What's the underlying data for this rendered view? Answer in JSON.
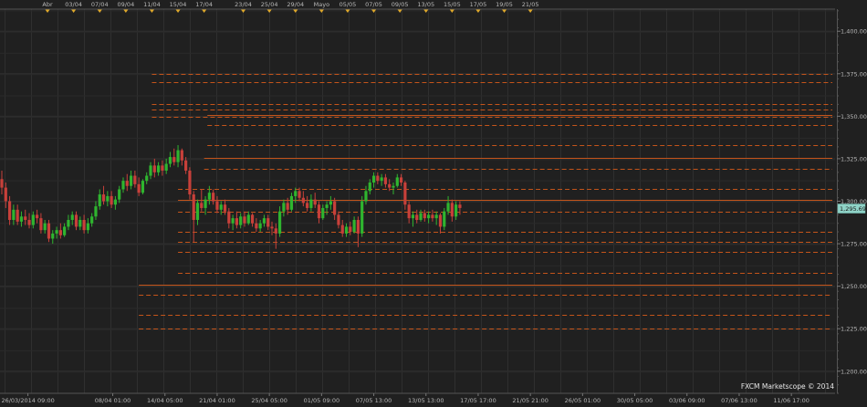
{
  "watermark": "FXCM Marketscope © 2014",
  "colors": {
    "background": "#202020",
    "grid": "#2f2f2f",
    "bull": "#2fb52f",
    "bear": "#c8403a",
    "level_line": "#c4541a",
    "price_box": "#8fd3c7",
    "marker": "#e0a92a"
  },
  "chart_data": {
    "type": "candlestick",
    "ylim": [
      1187,
      1413
    ],
    "xlim": [
      0,
      129
    ],
    "grid": true,
    "current_price_label": "1,295.69",
    "current_price": 1295.69,
    "y_ticks": [
      {
        "value": 1400,
        "label": "1,400.00"
      },
      {
        "value": 1375,
        "label": "1,375.00"
      },
      {
        "value": 1350,
        "label": "1,350.00"
      },
      {
        "value": 1325,
        "label": "1,325.00"
      },
      {
        "value": 1300,
        "label": "1,300.00"
      },
      {
        "value": 1275,
        "label": "1,275.00"
      },
      {
        "value": 1250,
        "label": "1,250.00"
      },
      {
        "value": 1225,
        "label": "1,225.00"
      },
      {
        "value": 1200,
        "label": "1,200.00"
      }
    ],
    "top_axis": [
      {
        "x": 7,
        "label": "Abr"
      },
      {
        "x": 11,
        "label": "03/04"
      },
      {
        "x": 15,
        "label": "07/04"
      },
      {
        "x": 19,
        "label": "09/04"
      },
      {
        "x": 23,
        "label": "11/04"
      },
      {
        "x": 27,
        "label": "15/04"
      },
      {
        "x": 31,
        "label": "17/04"
      },
      {
        "x": 37,
        "label": "23/04"
      },
      {
        "x": 41,
        "label": "25/04"
      },
      {
        "x": 45,
        "label": "29/04"
      },
      {
        "x": 49,
        "label": "Mayo"
      },
      {
        "x": 53,
        "label": "05/05"
      },
      {
        "x": 57,
        "label": "07/05"
      },
      {
        "x": 61,
        "label": "09/05"
      },
      {
        "x": 65,
        "label": "13/05"
      },
      {
        "x": 69,
        "label": "15/05"
      },
      {
        "x": 73,
        "label": "17/05"
      },
      {
        "x": 77,
        "label": "19/05"
      },
      {
        "x": 81,
        "label": "21/05"
      }
    ],
    "bottom_axis": [
      {
        "x": 4,
        "label": "26/03/2014 09:00"
      },
      {
        "x": 17,
        "label": "08/04 01:00"
      },
      {
        "x": 25,
        "label": "14/04 05:00"
      },
      {
        "x": 33,
        "label": "21/04 01:00"
      },
      {
        "x": 41,
        "label": "25/04 05:00"
      },
      {
        "x": 49,
        "label": "01/05 09:00"
      },
      {
        "x": 57,
        "label": "07/05 13:00"
      },
      {
        "x": 65,
        "label": "13/05 13:00"
      },
      {
        "x": 73,
        "label": "17/05 17:00"
      },
      {
        "x": 81,
        "label": "21/05 21:00"
      },
      {
        "x": 89,
        "label": "26/05 01:00"
      },
      {
        "x": 97,
        "label": "30/05 05:00"
      },
      {
        "x": 105,
        "label": "03/06 09:00"
      },
      {
        "x": 113,
        "label": "07/06 13:00"
      },
      {
        "x": 121,
        "label": "11/06 17:00"
      }
    ],
    "levels": [
      {
        "price": 1375.0,
        "x_from": 23.0,
        "style": "dashed"
      },
      {
        "price": 1370.0,
        "x_from": 23.0,
        "style": "dashed"
      },
      {
        "price": 1357.0,
        "x_from": 23.0,
        "style": "dashed"
      },
      {
        "price": 1354.0,
        "x_from": 23.0,
        "style": "dashed"
      },
      {
        "price": 1350.5,
        "x_from": 31.5,
        "style": "solid"
      },
      {
        "price": 1349.5,
        "x_from": 23.0,
        "style": "dashed"
      },
      {
        "price": 1345.0,
        "x_from": 31.5,
        "style": "dashed"
      },
      {
        "price": 1333.0,
        "x_from": 31.5,
        "style": "dashed"
      },
      {
        "price": 1325.5,
        "x_from": 31.0,
        "style": "solid"
      },
      {
        "price": 1319.0,
        "x_from": 31.0,
        "style": "dashed"
      },
      {
        "price": 1307.0,
        "x_from": 27.0,
        "style": "dashed"
      },
      {
        "price": 1301.0,
        "x_from": 27.0,
        "style": "solid"
      },
      {
        "price": 1294.0,
        "x_from": 27.0,
        "style": "dashed"
      },
      {
        "price": 1282.0,
        "x_from": 27.0,
        "style": "dashed"
      },
      {
        "price": 1276.0,
        "x_from": 27.0,
        "style": "dashed"
      },
      {
        "price": 1270.0,
        "x_from": 27.0,
        "style": "dashed"
      },
      {
        "price": 1258.0,
        "x_from": 27.0,
        "style": "dashed"
      },
      {
        "price": 1251.0,
        "x_from": 21.0,
        "style": "solid"
      },
      {
        "price": 1245.0,
        "x_from": 21.0,
        "style": "dashed"
      },
      {
        "price": 1233.0,
        "x_from": 21.0,
        "style": "dashed"
      },
      {
        "price": 1225.0,
        "x_from": 21.0,
        "style": "dashed"
      }
    ],
    "candles": [
      {
        "x": 0.0,
        "o": 1313,
        "h": 1318,
        "l": 1304,
        "c": 1308
      },
      {
        "x": 0.6,
        "o": 1308,
        "h": 1311,
        "l": 1296,
        "c": 1300
      },
      {
        "x": 1.2,
        "o": 1300,
        "h": 1303,
        "l": 1286,
        "c": 1289
      },
      {
        "x": 1.8,
        "o": 1289,
        "h": 1298,
        "l": 1286,
        "c": 1295
      },
      {
        "x": 2.4,
        "o": 1295,
        "h": 1298,
        "l": 1286,
        "c": 1288
      },
      {
        "x": 3.0,
        "o": 1288,
        "h": 1294,
        "l": 1285,
        "c": 1291
      },
      {
        "x": 3.6,
        "o": 1291,
        "h": 1295,
        "l": 1286,
        "c": 1289
      },
      {
        "x": 4.2,
        "o": 1289,
        "h": 1293,
        "l": 1284,
        "c": 1286
      },
      {
        "x": 4.8,
        "o": 1286,
        "h": 1294,
        "l": 1284,
        "c": 1292
      },
      {
        "x": 5.4,
        "o": 1292,
        "h": 1295,
        "l": 1287,
        "c": 1290
      },
      {
        "x": 6.0,
        "o": 1290,
        "h": 1293,
        "l": 1281,
        "c": 1283
      },
      {
        "x": 6.6,
        "o": 1283,
        "h": 1289,
        "l": 1281,
        "c": 1287
      },
      {
        "x": 7.2,
        "o": 1287,
        "h": 1289,
        "l": 1276,
        "c": 1278
      },
      {
        "x": 7.8,
        "o": 1278,
        "h": 1283,
        "l": 1275,
        "c": 1281
      },
      {
        "x": 8.4,
        "o": 1281,
        "h": 1285,
        "l": 1278,
        "c": 1283
      },
      {
        "x": 9.0,
        "o": 1283,
        "h": 1287,
        "l": 1278,
        "c": 1280
      },
      {
        "x": 9.6,
        "o": 1280,
        "h": 1287,
        "l": 1279,
        "c": 1285
      },
      {
        "x": 10.2,
        "o": 1285,
        "h": 1292,
        "l": 1283,
        "c": 1289
      },
      {
        "x": 10.8,
        "o": 1289,
        "h": 1294,
        "l": 1286,
        "c": 1292
      },
      {
        "x": 11.4,
        "o": 1292,
        "h": 1294,
        "l": 1283,
        "c": 1285
      },
      {
        "x": 12.0,
        "o": 1285,
        "h": 1291,
        "l": 1283,
        "c": 1289
      },
      {
        "x": 12.6,
        "o": 1289,
        "h": 1292,
        "l": 1281,
        "c": 1283
      },
      {
        "x": 13.2,
        "o": 1283,
        "h": 1290,
        "l": 1281,
        "c": 1287
      },
      {
        "x": 13.8,
        "o": 1287,
        "h": 1293,
        "l": 1285,
        "c": 1291
      },
      {
        "x": 14.4,
        "o": 1291,
        "h": 1300,
        "l": 1289,
        "c": 1297
      },
      {
        "x": 15.0,
        "o": 1297,
        "h": 1307,
        "l": 1295,
        "c": 1304
      },
      {
        "x": 15.6,
        "o": 1304,
        "h": 1309,
        "l": 1298,
        "c": 1300
      },
      {
        "x": 16.2,
        "o": 1300,
        "h": 1306,
        "l": 1297,
        "c": 1303
      },
      {
        "x": 16.8,
        "o": 1303,
        "h": 1306,
        "l": 1296,
        "c": 1298
      },
      {
        "x": 17.4,
        "o": 1298,
        "h": 1303,
        "l": 1295,
        "c": 1301
      },
      {
        "x": 18.0,
        "o": 1301,
        "h": 1309,
        "l": 1299,
        "c": 1307
      },
      {
        "x": 18.6,
        "o": 1307,
        "h": 1314,
        "l": 1305,
        "c": 1312
      },
      {
        "x": 19.2,
        "o": 1312,
        "h": 1316,
        "l": 1306,
        "c": 1309
      },
      {
        "x": 19.8,
        "o": 1309,
        "h": 1318,
        "l": 1307,
        "c": 1315
      },
      {
        "x": 20.4,
        "o": 1315,
        "h": 1318,
        "l": 1308,
        "c": 1310
      },
      {
        "x": 21.0,
        "o": 1310,
        "h": 1314,
        "l": 1303,
        "c": 1305
      },
      {
        "x": 21.6,
        "o": 1305,
        "h": 1313,
        "l": 1304,
        "c": 1312
      },
      {
        "x": 22.2,
        "o": 1312,
        "h": 1317,
        "l": 1310,
        "c": 1315
      },
      {
        "x": 22.8,
        "o": 1315,
        "h": 1323,
        "l": 1313,
        "c": 1321
      },
      {
        "x": 23.4,
        "o": 1321,
        "h": 1325,
        "l": 1314,
        "c": 1317
      },
      {
        "x": 24.0,
        "o": 1317,
        "h": 1323,
        "l": 1315,
        "c": 1321
      },
      {
        "x": 24.6,
        "o": 1321,
        "h": 1324,
        "l": 1315,
        "c": 1318
      },
      {
        "x": 25.2,
        "o": 1318,
        "h": 1325,
        "l": 1316,
        "c": 1322
      },
      {
        "x": 25.8,
        "o": 1322,
        "h": 1329,
        "l": 1320,
        "c": 1326
      },
      {
        "x": 26.4,
        "o": 1326,
        "h": 1331,
        "l": 1321,
        "c": 1323
      },
      {
        "x": 27.0,
        "o": 1323,
        "h": 1333,
        "l": 1320,
        "c": 1330
      },
      {
        "x": 27.6,
        "o": 1330,
        "h": 1331,
        "l": 1321,
        "c": 1324
      },
      {
        "x": 28.2,
        "o": 1324,
        "h": 1326,
        "l": 1316,
        "c": 1318
      },
      {
        "x": 28.8,
        "o": 1318,
        "h": 1320,
        "l": 1301,
        "c": 1304
      },
      {
        "x": 29.4,
        "o": 1304,
        "h": 1306,
        "l": 1276,
        "c": 1289
      },
      {
        "x": 30.0,
        "o": 1289,
        "h": 1301,
        "l": 1286,
        "c": 1299
      },
      {
        "x": 30.6,
        "o": 1299,
        "h": 1307,
        "l": 1294,
        "c": 1296
      },
      {
        "x": 31.2,
        "o": 1296,
        "h": 1303,
        "l": 1292,
        "c": 1301
      },
      {
        "x": 31.8,
        "o": 1301,
        "h": 1309,
        "l": 1298,
        "c": 1305
      },
      {
        "x": 32.4,
        "o": 1305,
        "h": 1307,
        "l": 1298,
        "c": 1300
      },
      {
        "x": 33.0,
        "o": 1300,
        "h": 1303,
        "l": 1293,
        "c": 1295
      },
      {
        "x": 33.6,
        "o": 1295,
        "h": 1300,
        "l": 1292,
        "c": 1298
      },
      {
        "x": 34.2,
        "o": 1298,
        "h": 1301,
        "l": 1292,
        "c": 1294
      },
      {
        "x": 34.8,
        "o": 1294,
        "h": 1296,
        "l": 1284,
        "c": 1287
      },
      {
        "x": 35.4,
        "o": 1287,
        "h": 1292,
        "l": 1283,
        "c": 1290
      },
      {
        "x": 36.0,
        "o": 1290,
        "h": 1294,
        "l": 1284,
        "c": 1286
      },
      {
        "x": 36.6,
        "o": 1286,
        "h": 1293,
        "l": 1284,
        "c": 1291
      },
      {
        "x": 37.2,
        "o": 1291,
        "h": 1294,
        "l": 1285,
        "c": 1287
      },
      {
        "x": 37.8,
        "o": 1287,
        "h": 1294,
        "l": 1286,
        "c": 1292
      },
      {
        "x": 38.4,
        "o": 1292,
        "h": 1293,
        "l": 1285,
        "c": 1287
      },
      {
        "x": 39.0,
        "o": 1287,
        "h": 1290,
        "l": 1282,
        "c": 1284
      },
      {
        "x": 39.6,
        "o": 1284,
        "h": 1289,
        "l": 1282,
        "c": 1287
      },
      {
        "x": 40.2,
        "o": 1287,
        "h": 1292,
        "l": 1285,
        "c": 1290
      },
      {
        "x": 40.8,
        "o": 1290,
        "h": 1292,
        "l": 1283,
        "c": 1285
      },
      {
        "x": 41.4,
        "o": 1285,
        "h": 1288,
        "l": 1280,
        "c": 1284
      },
      {
        "x": 42.0,
        "o": 1284,
        "h": 1287,
        "l": 1272,
        "c": 1281
      },
      {
        "x": 42.6,
        "o": 1281,
        "h": 1297,
        "l": 1279,
        "c": 1294
      },
      {
        "x": 43.2,
        "o": 1294,
        "h": 1301,
        "l": 1291,
        "c": 1299
      },
      {
        "x": 43.8,
        "o": 1299,
        "h": 1302,
        "l": 1292,
        "c": 1295
      },
      {
        "x": 44.4,
        "o": 1295,
        "h": 1305,
        "l": 1294,
        "c": 1303
      },
      {
        "x": 45.0,
        "o": 1303,
        "h": 1308,
        "l": 1299,
        "c": 1306
      },
      {
        "x": 45.6,
        "o": 1306,
        "h": 1308,
        "l": 1300,
        "c": 1302
      },
      {
        "x": 46.2,
        "o": 1302,
        "h": 1306,
        "l": 1297,
        "c": 1299
      },
      {
        "x": 46.8,
        "o": 1299,
        "h": 1303,
        "l": 1294,
        "c": 1296
      },
      {
        "x": 47.4,
        "o": 1296,
        "h": 1304,
        "l": 1294,
        "c": 1301
      },
      {
        "x": 48.0,
        "o": 1301,
        "h": 1305,
        "l": 1296,
        "c": 1298
      },
      {
        "x": 48.6,
        "o": 1298,
        "h": 1300,
        "l": 1287,
        "c": 1290
      },
      {
        "x": 49.2,
        "o": 1290,
        "h": 1298,
        "l": 1289,
        "c": 1296
      },
      {
        "x": 49.8,
        "o": 1296,
        "h": 1300,
        "l": 1292,
        "c": 1298
      },
      {
        "x": 50.4,
        "o": 1298,
        "h": 1303,
        "l": 1295,
        "c": 1300
      },
      {
        "x": 51.0,
        "o": 1300,
        "h": 1302,
        "l": 1289,
        "c": 1292
      },
      {
        "x": 51.6,
        "o": 1292,
        "h": 1294,
        "l": 1284,
        "c": 1286
      },
      {
        "x": 52.2,
        "o": 1286,
        "h": 1289,
        "l": 1279,
        "c": 1281
      },
      {
        "x": 52.8,
        "o": 1281,
        "h": 1287,
        "l": 1279,
        "c": 1285
      },
      {
        "x": 53.4,
        "o": 1285,
        "h": 1288,
        "l": 1280,
        "c": 1282
      },
      {
        "x": 54.0,
        "o": 1282,
        "h": 1291,
        "l": 1281,
        "c": 1289
      },
      {
        "x": 54.6,
        "o": 1289,
        "h": 1291,
        "l": 1273,
        "c": 1281
      },
      {
        "x": 55.2,
        "o": 1281,
        "h": 1303,
        "l": 1279,
        "c": 1300
      },
      {
        "x": 55.8,
        "o": 1300,
        "h": 1309,
        "l": 1298,
        "c": 1306
      },
      {
        "x": 56.4,
        "o": 1306,
        "h": 1313,
        "l": 1304,
        "c": 1311
      },
      {
        "x": 57.0,
        "o": 1311,
        "h": 1317,
        "l": 1308,
        "c": 1315
      },
      {
        "x": 57.6,
        "o": 1315,
        "h": 1317,
        "l": 1310,
        "c": 1312
      },
      {
        "x": 58.2,
        "o": 1312,
        "h": 1316,
        "l": 1309,
        "c": 1314
      },
      {
        "x": 58.8,
        "o": 1314,
        "h": 1316,
        "l": 1308,
        "c": 1310
      },
      {
        "x": 59.4,
        "o": 1310,
        "h": 1313,
        "l": 1306,
        "c": 1308
      },
      {
        "x": 60.0,
        "o": 1308,
        "h": 1311,
        "l": 1304,
        "c": 1309
      },
      {
        "x": 60.6,
        "o": 1309,
        "h": 1316,
        "l": 1308,
        "c": 1314
      },
      {
        "x": 61.2,
        "o": 1314,
        "h": 1316,
        "l": 1309,
        "c": 1311
      },
      {
        "x": 61.8,
        "o": 1311,
        "h": 1312,
        "l": 1295,
        "c": 1298
      },
      {
        "x": 62.4,
        "o": 1298,
        "h": 1300,
        "l": 1287,
        "c": 1290
      },
      {
        "x": 63.0,
        "o": 1290,
        "h": 1294,
        "l": 1285,
        "c": 1292
      },
      {
        "x": 63.6,
        "o": 1292,
        "h": 1295,
        "l": 1287,
        "c": 1289
      },
      {
        "x": 64.2,
        "o": 1289,
        "h": 1295,
        "l": 1288,
        "c": 1293
      },
      {
        "x": 64.8,
        "o": 1293,
        "h": 1295,
        "l": 1288,
        "c": 1290
      },
      {
        "x": 65.4,
        "o": 1290,
        "h": 1294,
        "l": 1287,
        "c": 1292
      },
      {
        "x": 66.0,
        "o": 1292,
        "h": 1295,
        "l": 1288,
        "c": 1290
      },
      {
        "x": 66.6,
        "o": 1290,
        "h": 1294,
        "l": 1286,
        "c": 1292
      },
      {
        "x": 67.2,
        "o": 1292,
        "h": 1293,
        "l": 1281,
        "c": 1285
      },
      {
        "x": 67.8,
        "o": 1285,
        "h": 1296,
        "l": 1283,
        "c": 1294
      },
      {
        "x": 68.4,
        "o": 1294,
        "h": 1303,
        "l": 1292,
        "c": 1299
      },
      {
        "x": 69.0,
        "o": 1299,
        "h": 1301,
        "l": 1288,
        "c": 1291
      },
      {
        "x": 69.6,
        "o": 1291,
        "h": 1300,
        "l": 1289,
        "c": 1298
      },
      {
        "x": 70.2,
        "o": 1298,
        "h": 1300,
        "l": 1292,
        "c": 1296
      }
    ]
  }
}
